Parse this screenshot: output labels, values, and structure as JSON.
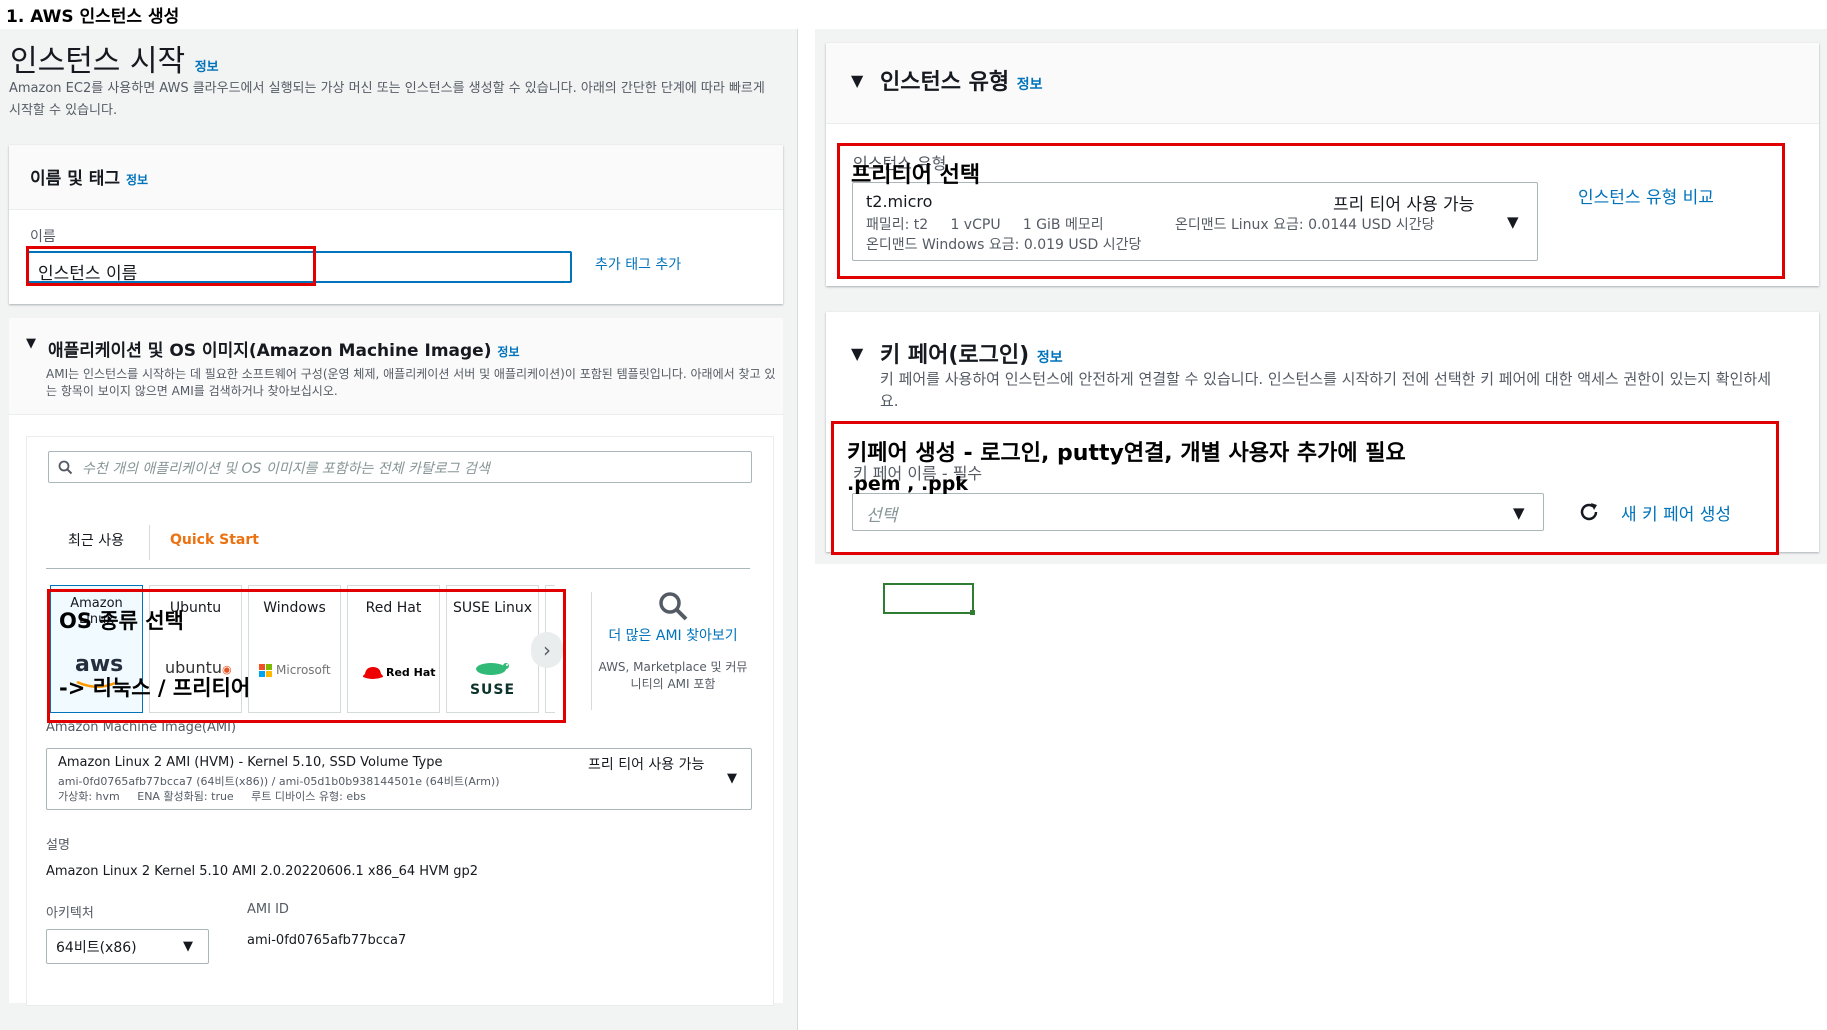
{
  "doc": {
    "heading": "1. AWS 인스턴스 생성"
  },
  "launch": {
    "title": "인스턴스 시작",
    "info": "정보",
    "description": "Amazon EC2를 사용하면 AWS 클라우드에서 실행되는 가상 머신 또는 인스턴스를 생성할 수 있습니다. 아래의 간단한 단계에 따라 빠르게 시작할 수 있습니다."
  },
  "name_tags": {
    "title": "이름 및 태그",
    "info": "정보",
    "name_label": "이름",
    "name_value": "인스턴스 이름",
    "add_tag": "추가 태그 추가"
  },
  "ami": {
    "title": "애플리케이션 및 OS 이미지(Amazon Machine Image)",
    "info": "정보",
    "description": "AMI는 인스턴스를 시작하는 데 필요한 소프트웨어 구성(운영 체제, 애플리케이션 서버 및 애플리케이션)이 포함된 템플릿입니다. 아래에서 찾고 있는 항목이 보이지 않으면 AMI를 검색하거나 찾아보십시오.",
    "search_placeholder": "수천 개의 애플리케이션 및 OS 이미지를 포함하는 전체 카탈로그 검색",
    "tabs": [
      "최근 사용",
      "Quick Start"
    ],
    "os_tiles": [
      {
        "name": "Amazon Linux",
        "logo": "aws"
      },
      {
        "name": "Ubuntu",
        "logo": "ubuntu"
      },
      {
        "name": "Windows",
        "logo": "Microsoft"
      },
      {
        "name": "Red Hat",
        "logo": "Red Hat"
      },
      {
        "name": "SUSE Linux",
        "logo": "SUSE"
      }
    ],
    "more_link": "더 많은 AMI 찾아보기",
    "more_sub": "AWS, Marketplace 및 커뮤니티의 AMI 포함",
    "image_label": "Amazon Machine Image(AMI)",
    "selected_name": "Amazon Linux 2 AMI (HVM) - Kernel 5.10, SSD Volume Type",
    "selected_ids": "ami-0fd0765afb77bcca7 (64비트(x86)) / ami-05d1b0b938144501e (64비트(Arm))",
    "selected_meta": "가상화: hvm     ENA 활성화됨: true     루트 디바이스 유형: ebs",
    "free_tier": "프리 티어 사용 가능",
    "desc_label": "설명",
    "desc_value": "Amazon Linux 2 Kernel 5.10 AMI 2.0.20220606.1 x86_64 HVM gp2",
    "arch_label": "아키텍처",
    "arch_value": "64비트(x86)",
    "amiid_label": "AMI ID",
    "amiid_value": "ami-0fd0765afb77bcca7"
  },
  "instance_type": {
    "title": "인스턴스 유형",
    "info": "정보",
    "field_label": "인스턴스 유형",
    "name": "t2.micro",
    "free_tier": "프리 티어 사용 가능",
    "specs": "패밀리: t2     1 vCPU     1 GiB 메모리",
    "linux_price": "온디맨드 Linux 요금: 0.0144 USD 시간당",
    "windows_price": "온디맨드 Windows 요금: 0.019 USD 시간당",
    "compare": "인스턴스 유형 비교"
  },
  "key_pair": {
    "title": "키 페어(로그인)",
    "info": "정보",
    "description": "키 페어를 사용하여 인스턴스에 안전하게 연결할 수 있습니다. 인스턴스를 시작하기 전에 선택한 키 페어에 대한 액세스 권한이 있는지 확인하세요.",
    "field_label": "키 페어 이름 - 필수",
    "placeholder": "선택",
    "create": "새 키 페어 생성"
  },
  "annotations": {
    "free_tier": "프리티어 선택",
    "os_line1": "OS 종류 선택",
    "os_line2": "-> 리눅스 / 프리티어",
    "key_line1": "키페어 생성 - 로그인, putty연결, 개별 사용자 추가에 필요",
    "key_line2": ".pem , .ppk"
  },
  "colors": {
    "accent_orange": "#ec7211",
    "link_blue": "#0073bb",
    "annotation_red": "#e00000",
    "cell_green": "#2e7d32"
  }
}
